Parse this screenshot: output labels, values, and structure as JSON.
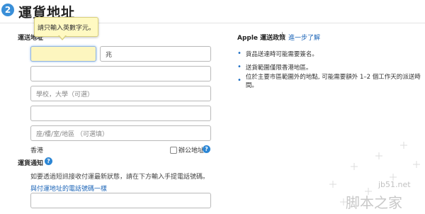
{
  "section": {
    "step_number": "2",
    "title": "運貨地址"
  },
  "address": {
    "field_label": "運送地址",
    "tooltip_text": "請只輸入英數字元。",
    "first_name_value": "",
    "last_name_value": "兆",
    "address_line1_value": "",
    "school_placeholder": "學校，大學（可選）",
    "address_line3_value": "",
    "building_placeholder": "座/樓/室/地區 （可選填）",
    "region": "香港",
    "office_label": "辦公地址"
  },
  "notification": {
    "label": "運貨通知",
    "description": "如要透過短訊接收付運最新狀態，請在下方輸入手提電話號碼。",
    "same_phone_link": "與付運地址的電話號碼一樣",
    "phone_value": ""
  },
  "policy": {
    "title": "Apple 運送政策",
    "learn_more": "進一步了解",
    "items": [
      "貨品送達時可能需要簽名。",
      "送貨範圍僅限香港地區。",
      "位於主要市區範圍外的地點, 可能需要額外 1–2 個工作天的派送時間。"
    ]
  },
  "watermark": {
    "url": "jb51.net",
    "text": "脚本之家"
  },
  "colors": {
    "accent_blue": "#2c86d4",
    "error_fill": "#fdf6bf",
    "link": "#1b64b7"
  }
}
